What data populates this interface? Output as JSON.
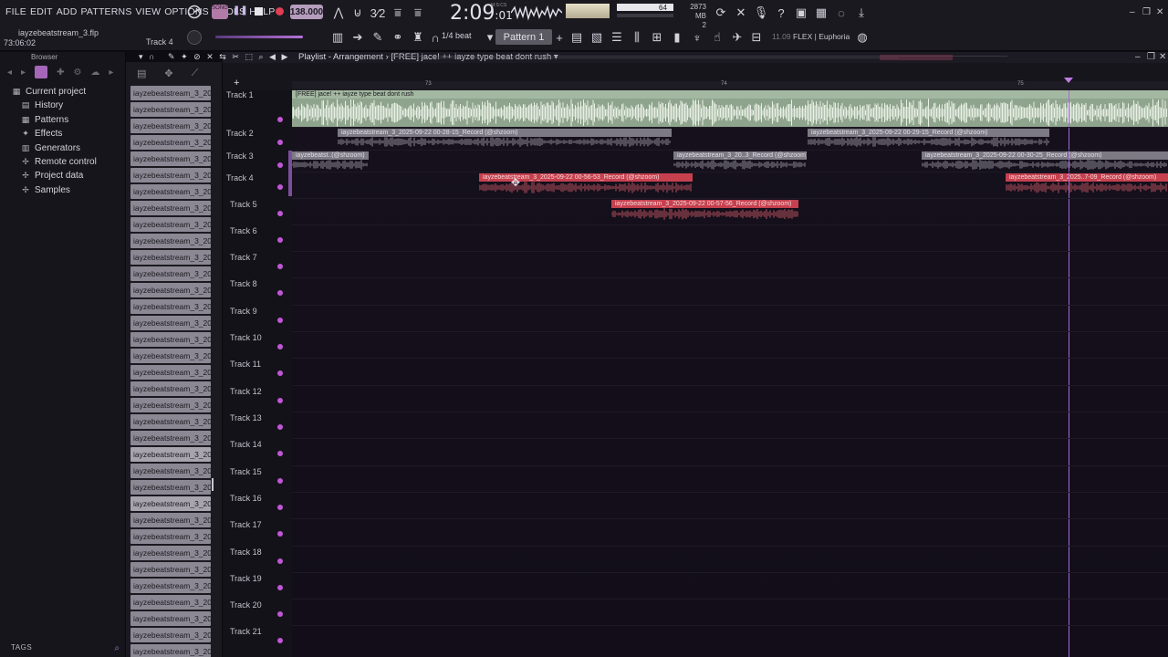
{
  "menu": [
    "FILE",
    "EDIT",
    "ADD",
    "PATTERNS",
    "VIEW",
    "OPTIONS",
    "TOOLS",
    "HELP"
  ],
  "project": {
    "file_name": "iayzebeatstream_3.flp",
    "song_time": "73:06:02",
    "focused_track": "Track 4"
  },
  "transport": {
    "pat_song_label": "SONG",
    "tempo": "138.000",
    "clock_main": "2:09",
    "clock_sub": "01",
    "clock_label": "M:S:CS"
  },
  "monitor": {
    "cpu": "64",
    "ram": "2873 MB",
    "poly": "2"
  },
  "toolbar2": {
    "snap": "1/4 beat",
    "pattern": "Pattern 1",
    "hint_version": "11.09",
    "hint_text": "FLEX | Euphoria"
  },
  "browser": {
    "title": "Browser",
    "items": [
      {
        "label": "Current project",
        "icon": "project-icon",
        "level": "top"
      },
      {
        "label": "History",
        "icon": "history-icon",
        "level": "sub"
      },
      {
        "label": "Patterns",
        "icon": "patterns-icon",
        "level": "sub"
      },
      {
        "label": "Effects",
        "icon": "effects-icon",
        "level": "sub"
      },
      {
        "label": "Generators",
        "icon": "generators-icon",
        "level": "sub"
      },
      {
        "label": "Remote control",
        "icon": "remote-icon",
        "level": "sub"
      },
      {
        "label": "Project data",
        "icon": "data-icon",
        "level": "sub"
      },
      {
        "label": "Samples",
        "icon": "samples-icon",
        "level": "sub"
      }
    ],
    "tags_label": "TAGS"
  },
  "channels": {
    "label": "iayzebeatstream_3_2025...",
    "count": 35
  },
  "playlist": {
    "title": "Playlist - Arrangement",
    "song": "[FREE] jace! ++ iayze type beat dont rush",
    "ruler": [
      "73",
      "74",
      "75"
    ],
    "tracks": [
      "Track 1",
      "Track 2",
      "Track 3",
      "Track 4",
      "Track 5",
      "Track 6",
      "Track 7",
      "Track 8",
      "Track 9",
      "Track 10",
      "Track 11",
      "Track 12",
      "Track 13",
      "Track 14",
      "Track 15",
      "Track 16",
      "Track 17",
      "Track 18",
      "Track 19",
      "Track 20",
      "Track 21"
    ],
    "clips": {
      "master": "[FREE] jace! ++ iayze type beat dont rush",
      "t2a": "iayzebeatstream_3_2025-09-22 00-28-15_Record (@shzoom)",
      "t2b": "iayzebeatstream_3_2025-09-22 00-29-15_Record (@shzoom)",
      "t3a": "iayzebeatst..(@shzoom)",
      "t3b": "iayzebeatstream_3_20..3_Record (@shzoom)",
      "t3c": "iayzebeatstream_3_2025-09-22 00-30-25_Record (@shzoom)",
      "t4a": "iayzebeatstream_3_2025-09-22 00-56-53_Record (@shzoom)",
      "t4b": "iayzebeatstream_3_2025..7-09_Record (@shzoom)",
      "t5a": "iayzebeatstream_3_2025-09-22 00-57-56_Record (@shzoom)"
    }
  },
  "colors": {
    "accent": "#a566b9",
    "master_clip": "#a3b8a0",
    "vocal_clip": "#c6404e",
    "gray_clip": "#7d7a84",
    "playhead": "#a66ad5"
  }
}
